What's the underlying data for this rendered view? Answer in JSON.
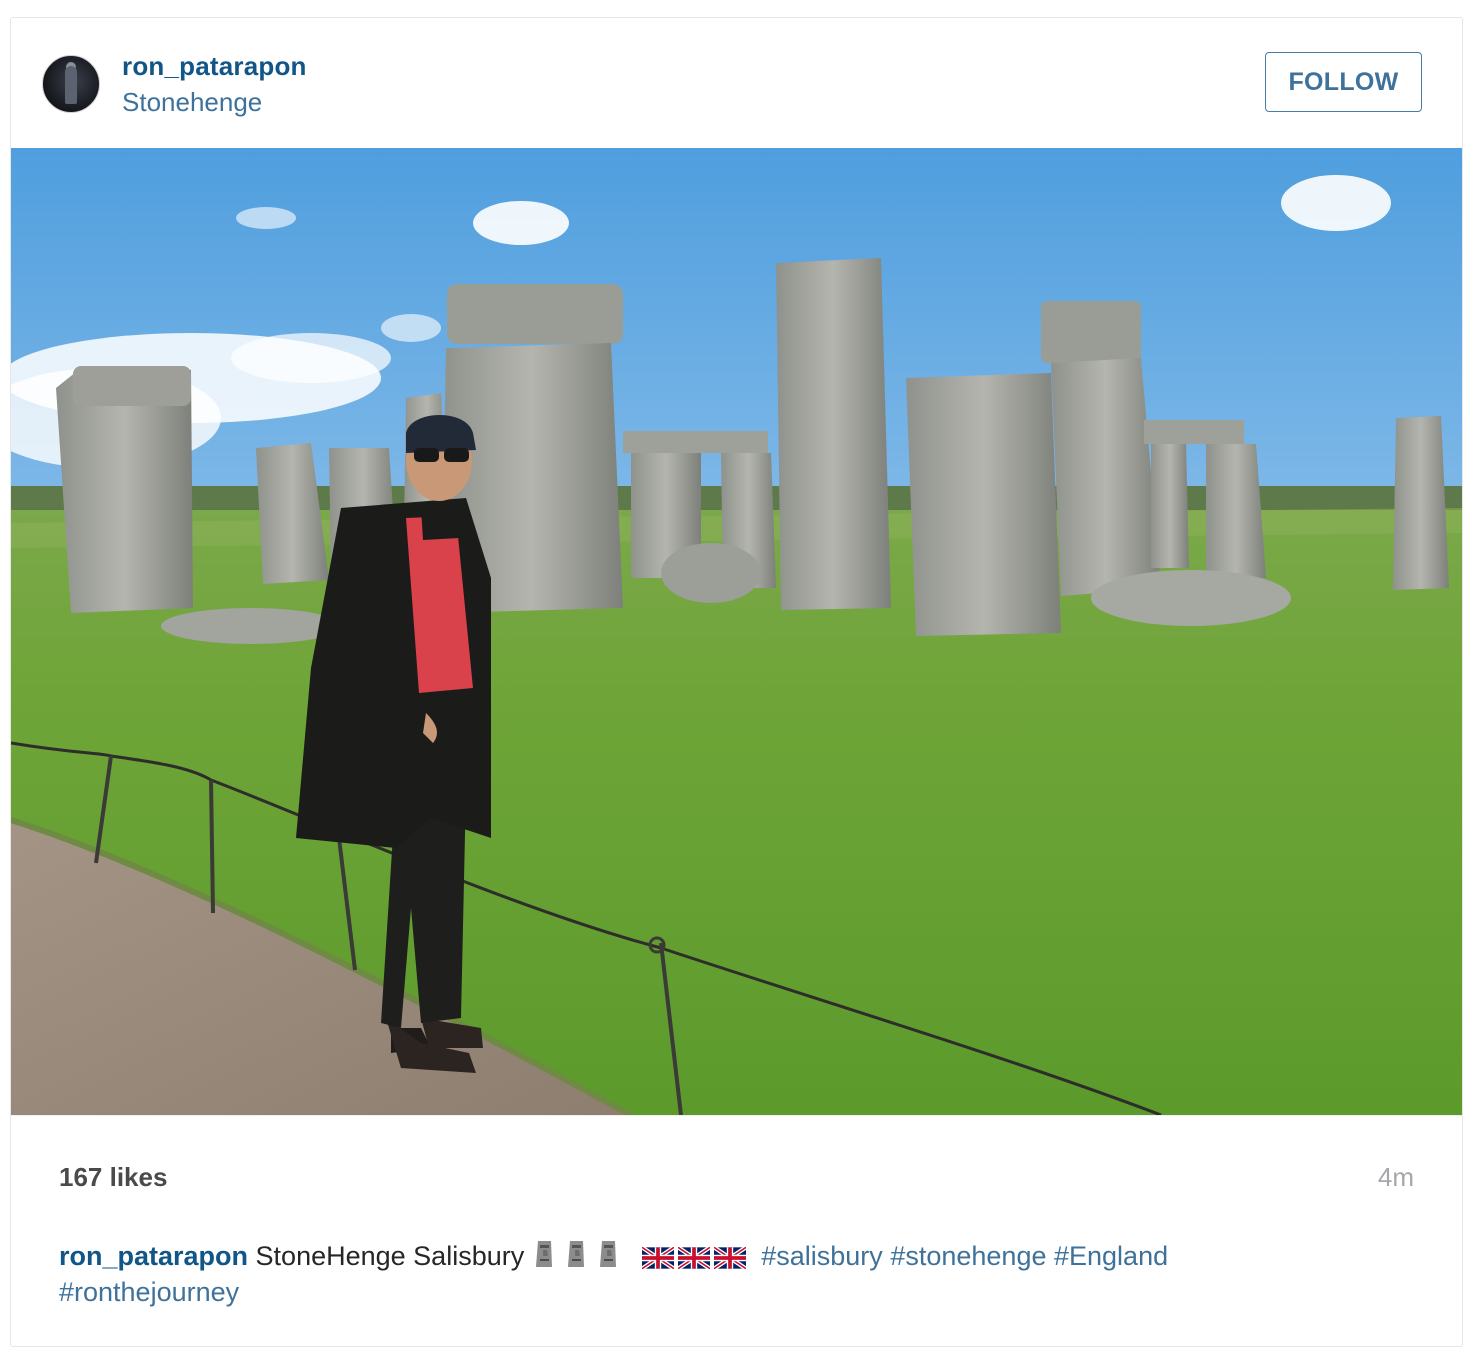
{
  "post": {
    "username": "ron_patarapon",
    "location": "Stonehenge",
    "follow_label": "FOLLOW",
    "photo_alt": "Man standing in front of Stonehenge on green grass",
    "likes": "167 likes",
    "time": "4m"
  },
  "caption": {
    "username": "ron_patarapon",
    "text": "StoneHenge Salisbury",
    "emojis": [
      "moai-emoji",
      "moai-emoji",
      "moai-emoji",
      "uk-flag-emoji",
      "uk-flag-emoji",
      "uk-flag-emoji"
    ],
    "hashtags": [
      "#salisbury",
      "#stonehenge",
      "#England",
      "#ronthejourney"
    ]
  },
  "colors": {
    "username": "#125688",
    "link": "#3f729b",
    "follow_border": "#4a7da6",
    "time": "#a5a7aa"
  }
}
